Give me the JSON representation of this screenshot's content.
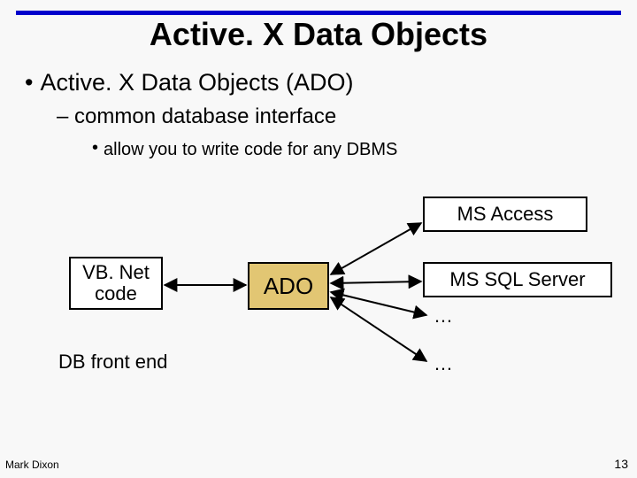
{
  "slide": {
    "title": "Active. X Data Objects",
    "bullet1": "Active. X Data Objects (ADO)",
    "bullet2": "– common database interface",
    "bullet3": "allow you to write code for any DBMS"
  },
  "diagram": {
    "vb": {
      "line1": "VB. Net",
      "line2": "code"
    },
    "ado": "ADO",
    "access": "MS Access",
    "sqlserver": "MS SQL Server",
    "ellipsis1": "…",
    "ellipsis2": "…",
    "frontend": "DB front end"
  },
  "footer": {
    "author": "Mark Dixon",
    "page": "13"
  }
}
